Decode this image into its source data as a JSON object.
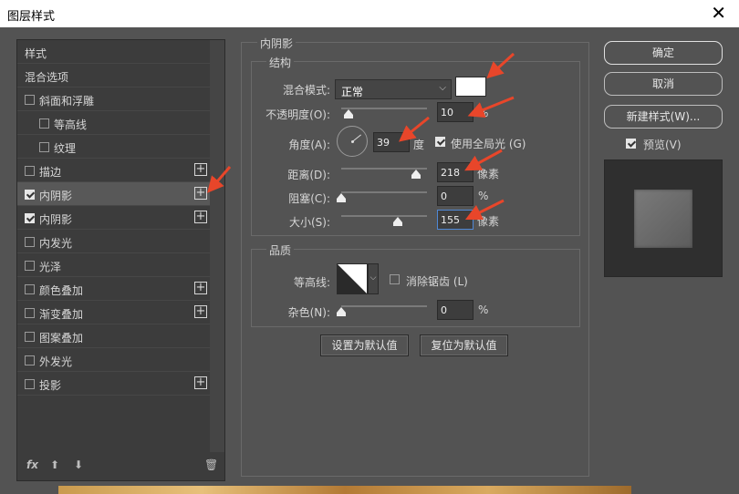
{
  "dialog": {
    "title": "图层样式",
    "close_glyph": "✕"
  },
  "left_panel": {
    "items": [
      {
        "label": "样式",
        "checkbox": false,
        "checked": false,
        "plus": false,
        "selected": false
      },
      {
        "label": "混合选项",
        "checkbox": false,
        "checked": false,
        "plus": false,
        "selected": false
      },
      {
        "label": "斜面和浮雕",
        "checkbox": true,
        "checked": false,
        "plus": false,
        "selected": false
      },
      {
        "label": "等高线",
        "checkbox": true,
        "checked": false,
        "plus": false,
        "selected": false
      },
      {
        "label": "纹理",
        "checkbox": true,
        "checked": false,
        "plus": false,
        "selected": false
      },
      {
        "label": "描边",
        "checkbox": true,
        "checked": false,
        "plus": true,
        "selected": false
      },
      {
        "label": "内阴影",
        "checkbox": true,
        "checked": true,
        "plus": true,
        "selected": true
      },
      {
        "label": "内阴影",
        "checkbox": true,
        "checked": true,
        "plus": true,
        "selected": false
      },
      {
        "label": "内发光",
        "checkbox": true,
        "checked": false,
        "plus": false,
        "selected": false
      },
      {
        "label": "光泽",
        "checkbox": true,
        "checked": false,
        "plus": false,
        "selected": false
      },
      {
        "label": "颜色叠加",
        "checkbox": true,
        "checked": false,
        "plus": true,
        "selected": false
      },
      {
        "label": "渐变叠加",
        "checkbox": true,
        "checked": false,
        "plus": true,
        "selected": false
      },
      {
        "label": "图案叠加",
        "checkbox": true,
        "checked": false,
        "plus": false,
        "selected": false
      },
      {
        "label": "外发光",
        "checkbox": true,
        "checked": false,
        "plus": false,
        "selected": false
      },
      {
        "label": "投影",
        "checkbox": true,
        "checked": false,
        "plus": true,
        "selected": false
      }
    ],
    "footer": {
      "fx": "fx",
      "up": "⬆",
      "down": "⬇",
      "trash": "🗑"
    }
  },
  "inner_shadow": {
    "section_title": "内阴影",
    "structure": {
      "title": "结构",
      "blend_mode_label": "混合模式:",
      "blend_mode_value": "正常",
      "color": "#ffffff",
      "opacity_label": "不透明度(O):",
      "opacity_value": "10",
      "opacity_unit": "%",
      "angle_label": "角度(A):",
      "angle_value": "39",
      "angle_unit": "度",
      "global_light_label": "使用全局光 (G)",
      "global_light_checked": true,
      "distance_label": "距离(D):",
      "distance_value": "218",
      "distance_unit": "像素",
      "choke_label": "阻塞(C):",
      "choke_value": "0",
      "choke_unit": "%",
      "size_label": "大小(S):",
      "size_value": "155",
      "size_unit": "像素"
    },
    "quality": {
      "title": "品质",
      "contour_label": "等高线:",
      "antialias_label": "消除锯齿 (L)",
      "antialias_checked": false,
      "noise_label": "杂色(N):",
      "noise_value": "0",
      "noise_unit": "%"
    },
    "set_default": "设置为默认值",
    "reset_default": "复位为默认值"
  },
  "right": {
    "ok": "确定",
    "cancel": "取消",
    "new_style": "新建样式(W)...",
    "preview_label": "预览(V)",
    "preview_checked": true
  },
  "colors": {
    "dialog_bg": "#535353",
    "annotation_arrow": "#e8462a"
  }
}
